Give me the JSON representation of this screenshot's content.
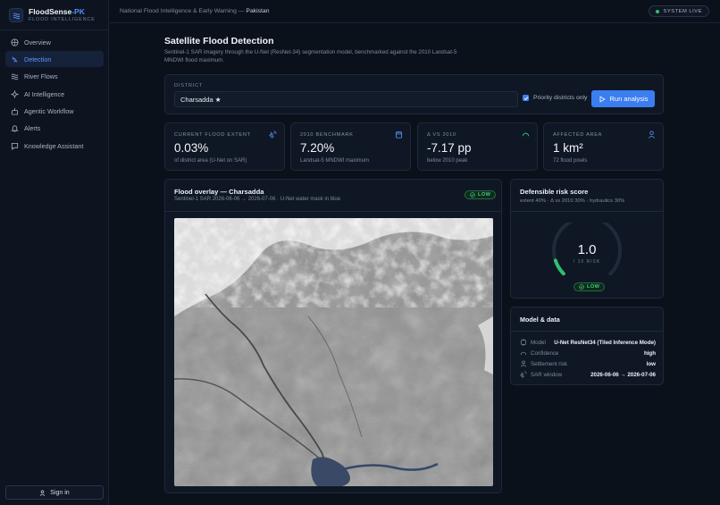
{
  "app": {
    "name": "FloodSense",
    "name_suffix": "-PK",
    "subtitle": "FLOOD INTELLIGENCE",
    "accent": "#3b7ef0"
  },
  "sidebar": {
    "items": [
      {
        "label": "Overview",
        "icon": "grid-icon",
        "active": false
      },
      {
        "label": "Detection",
        "icon": "waves-icon",
        "active": true
      },
      {
        "label": "River Flows",
        "icon": "river-icon",
        "active": false
      },
      {
        "label": "AI Intelligence",
        "icon": "sparkle-icon",
        "active": false
      },
      {
        "label": "Agentic Workflow",
        "icon": "workflow-icon",
        "active": false
      },
      {
        "label": "Alerts",
        "icon": "bell-icon",
        "active": false
      },
      {
        "label": "Knowledge Assistant",
        "icon": "chat-icon",
        "active": false
      }
    ],
    "signin_label": "Sign in"
  },
  "topbar": {
    "breadcrumb": "National Flood Intelligence & Early Warning — ",
    "country": "Pakistan",
    "status": "SYSTEM LIVE",
    "status_color": "#2fbf71"
  },
  "page": {
    "title": "Satellite Flood Detection",
    "subtitle": "Sentinel-1 SAR imagery through the U-Net (ResNet-34) segmentation model, benchmarked against the 2010 Landsat-5 MNDWI flood maximum."
  },
  "district": {
    "label": "DISTRICT",
    "value": "Charsadda ★",
    "priority_label": "Priority districts only",
    "priority_checked": true,
    "run_label": "Run analysis"
  },
  "metrics": [
    {
      "label": "CURRENT FLOOD EXTENT",
      "value": "0.03%",
      "note": "of district area (U-Net on SAR)",
      "icon": "satellite-icon"
    },
    {
      "label": "2010 BENCHMARK",
      "value": "7.20%",
      "note": "Landsat-5 MNDWI maximum",
      "icon": "calendar-icon"
    },
    {
      "label": "Δ VS 2010",
      "value": "-7.17 pp",
      "note": "below 2010 peak",
      "icon": "trend-icon"
    },
    {
      "label": "AFFECTED AREA",
      "value": "1 km²",
      "note": "72 flood pixels",
      "icon": "person-icon"
    }
  ],
  "overlay": {
    "title": "Flood overlay — Charsadda",
    "subtitle": "Sentinel-1 SAR 2026-06-06 → 2026-07-06 · U-Net water mask in blue",
    "badge": "LOW"
  },
  "risk": {
    "title": "Defensible risk score",
    "subtitle": "extent 40% · Δ vs 2010 30% · hydraulics 30%",
    "score": "1.0",
    "score_value": 1.0,
    "scale": "/ 10 RISK",
    "badge": "LOW",
    "gauge_color": "#2fbf71"
  },
  "model": {
    "title": "Model & data",
    "rows": [
      {
        "key": "Model",
        "value": "U-Net ResNet34 (Tiled Inference Mode)",
        "icon": "cpu-icon"
      },
      {
        "key": "Confidence",
        "value": "high",
        "icon": "gauge-icon"
      },
      {
        "key": "Settlement risk",
        "value": "low",
        "icon": "people-icon"
      },
      {
        "key": "SAR window",
        "value": "2026-06-06 → 2026-07-06",
        "icon": "satellite-icon"
      }
    ]
  }
}
